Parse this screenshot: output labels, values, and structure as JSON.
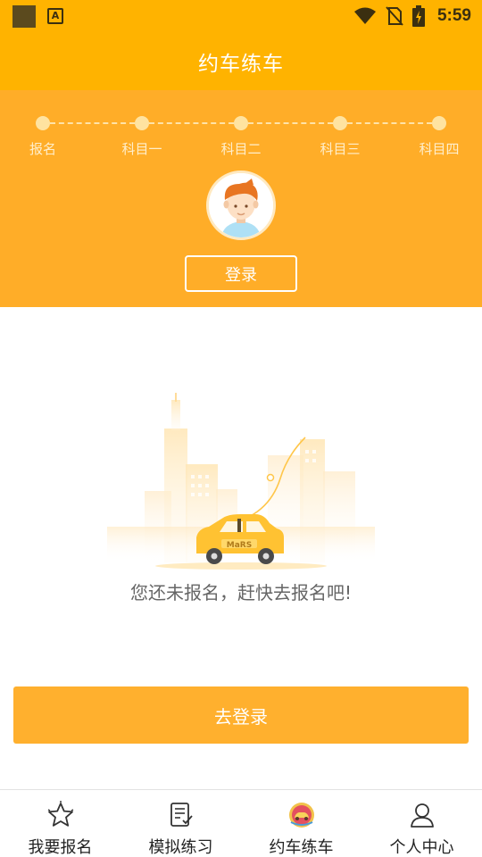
{
  "status_bar": {
    "time": "5:59",
    "notification_icon_letter": "A"
  },
  "header": {
    "title": "约车练车"
  },
  "progress": {
    "steps": [
      "报名",
      "科目一",
      "科目二",
      "科目三",
      "科目四"
    ]
  },
  "login_button_label": "登录",
  "illustration": {
    "car_label": "MaRS"
  },
  "empty_message": "您还未报名，赶快去报名吧!",
  "go_login_label": "去登录",
  "bottom_nav": {
    "items": [
      {
        "label": "我要报名",
        "icon": "star-icon"
      },
      {
        "label": "模拟练习",
        "icon": "document-check-icon"
      },
      {
        "label": "约车练车",
        "icon": "car-badge-icon",
        "active": true
      },
      {
        "label": "个人中心",
        "icon": "person-icon"
      }
    ]
  },
  "colors": {
    "primary": "#ffb300",
    "banner": "#ffad28",
    "button": "#ffb02e"
  }
}
